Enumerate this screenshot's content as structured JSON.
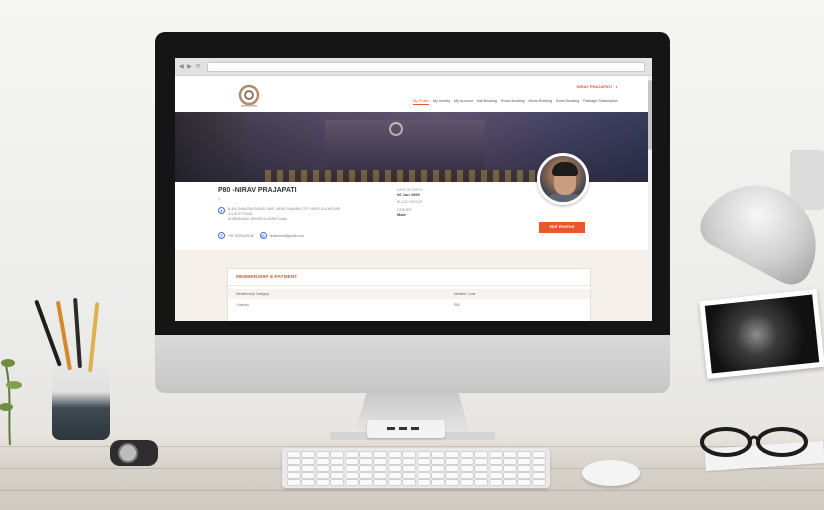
{
  "site": {
    "user_menu": "NIRAV PRAJAPATI",
    "user_menu_caret": "▼",
    "nav": [
      "My Profile",
      "My Activity",
      "My Account",
      "Hall Booking",
      "Room Booking",
      "Movie Booking",
      "Event Booking",
      "Package Subscription"
    ],
    "active_nav_index": 0
  },
  "profile": {
    "name": "P80 -NIRAV PRAJAPATI",
    "sub": "0",
    "address_line1": "B-404 SANATAN BUNGLOWS, NEAR SAHARA CITY, NEAR GULMOHAR",
    "address_line2": "CLUB ST ROAD",
    "address_line3": "AHMEDABAD 380058 GUJARAT India",
    "phone": "+91 9725120138",
    "email": "nrashbhra@gmail.com",
    "dob_label": "DATE OF BIRTH",
    "dob_value": "06 Jun 1990",
    "blood_group_label": "BLOOD GROUP",
    "gender_label": "GENDER",
    "gender_value": "Male",
    "edit_button": "EDIT PROFILE"
  },
  "membership": {
    "title": "MEMBERSHIP & PAYMENT",
    "columns": [
      "Membership Category",
      "Member Code"
    ],
    "row": [
      "Ordinary",
      "P80"
    ]
  },
  "colors": {
    "accent": "#e25b30",
    "button": "#e8582c",
    "icon_blue": "#3a6fd8"
  }
}
